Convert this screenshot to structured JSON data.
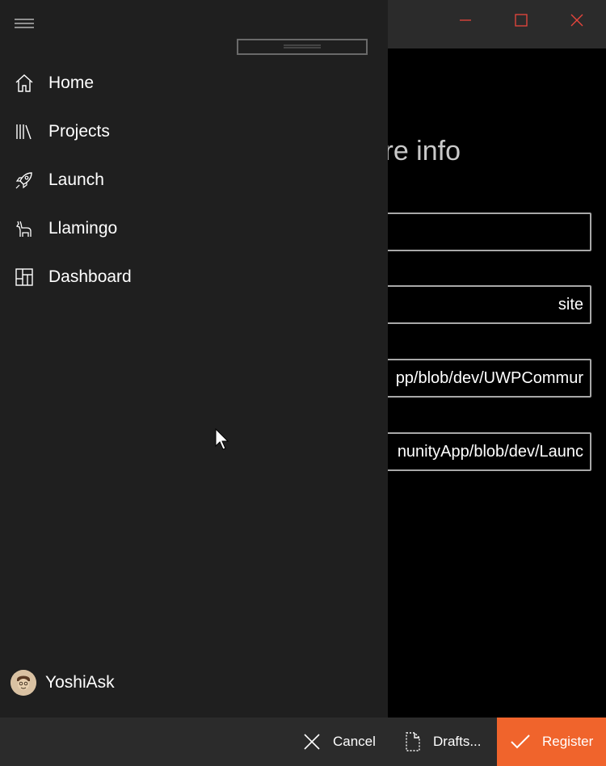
{
  "nav": {
    "items": [
      {
        "label": "Home",
        "icon": "home-icon"
      },
      {
        "label": "Projects",
        "icon": "library-icon"
      },
      {
        "label": "Launch",
        "icon": "rocket-icon"
      },
      {
        "label": "Llamingo",
        "icon": "llama-icon"
      },
      {
        "label": "Dashboard",
        "icon": "dashboard-icon"
      }
    ],
    "account": {
      "name": "YoshiAsk",
      "icon": "avatar"
    }
  },
  "form": {
    "heading_visible": "re info",
    "fields": [
      {
        "value": ""
      },
      {
        "value": "site"
      },
      {
        "value": "pp/blob/dev/UWPCommur"
      },
      {
        "value": "nunityApp/blob/dev/Launc"
      }
    ]
  },
  "commandbar": {
    "cancel_label": "Cancel",
    "drafts_label": "Drafts...",
    "register_label": "Register"
  },
  "colors": {
    "accent": "#f0642c",
    "nav_background": "#1f1f1f",
    "titlebar": "#2b2b2b",
    "close_icon": "#e8453c"
  }
}
